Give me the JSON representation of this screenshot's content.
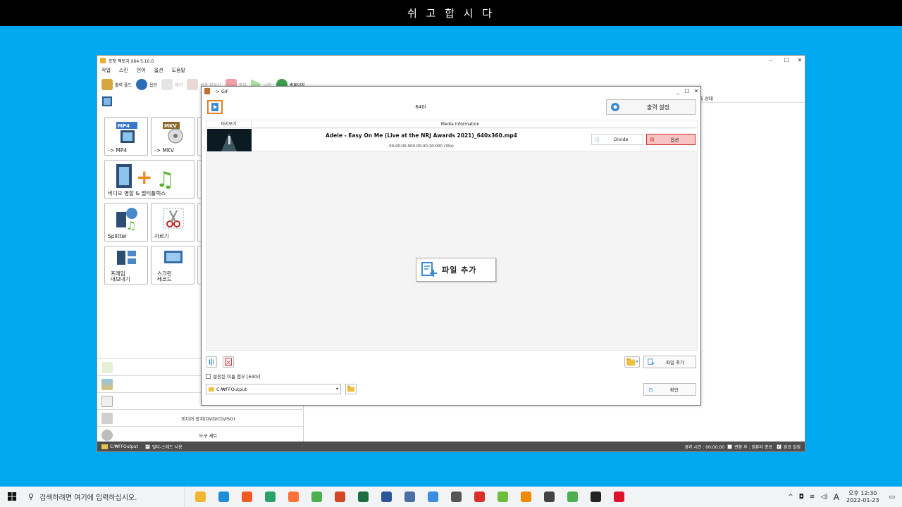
{
  "banner": "쉬 고 합 시 다",
  "main_window": {
    "title": "포맷 팩토리 X64 5.10.0",
    "menu": [
      "작업",
      "스킨",
      "언어",
      "옵션",
      "도움말"
    ],
    "toolbar": [
      {
        "label": "출력 폴드",
        "enabled": true,
        "icon": "output-folder-icon"
      },
      {
        "label": "옵션",
        "enabled": true,
        "icon": "options-icon"
      },
      {
        "label": "제거",
        "enabled": false,
        "icon": "remove-icon"
      },
      {
        "label": "목록 지우기",
        "enabled": false,
        "icon": "clear-list-icon"
      },
      {
        "label": "중지",
        "enabled": false,
        "icon": "stop-icon"
      },
      {
        "label": "시작",
        "enabled": false,
        "icon": "start-icon"
      },
      {
        "label": "홈페이지",
        "enabled": true,
        "icon": "homepage-icon"
      }
    ],
    "tiles": {
      "mp4": "-> MP4",
      "mkv": "-> MKV",
      "merge": "비디오 병합 & 멀티플렉스",
      "splitter": "Splitter",
      "crop": "자르기",
      "frame_export_l1": "프레임",
      "frame_export_l2": "내보내기",
      "screen_rec_l1": "스크린",
      "screen_rec_l2": "레코드"
    },
    "sidebar": [
      {
        "label": "",
        "icon": "audio-icon"
      },
      {
        "label": "",
        "icon": "image-icon"
      },
      {
        "label": "",
        "icon": "document-icon"
      },
      {
        "label": "미디어 장치(DVD/CD/ISO)",
        "icon": "disc-icon"
      },
      {
        "label": "도구 세트",
        "icon": "toolbox-icon"
      }
    ],
    "right_header_label": "출 상태",
    "status": {
      "path": "C:₩FFOutput",
      "multithread": "멀티-스레드 사용",
      "elapsed": "경과 시간 : 00:00:00",
      "after_convert": "변환 후 : 컴퓨터 종료",
      "notify": "완료 알림"
    }
  },
  "dialog": {
    "title": "-> GIF",
    "format": "640i",
    "output_settings_label": "출력 설정",
    "columns": {
      "preview": "미리보기",
      "media_info": "Media information"
    },
    "file": {
      "name": "Adele - Easy On Me (Live at the NRJ Awards 2021)_640x360.mp4",
      "duration": "00:00:00.000-00:00:30.000 (30s)",
      "divide_label": "Divide",
      "options_label": "옵션"
    },
    "add_file_big_label": "파일 추가",
    "add_file_small_label": "파일 추가",
    "attach_setting_name": "설정된 이름 첨부 [640i]",
    "output_path": "C:₩FFOutput",
    "ok_label": "확인"
  },
  "taskbar": {
    "search_placeholder": "검색하려면 여기에 입력하십시오.",
    "apps": [
      {
        "name": "file-explorer",
        "color": "#f2b632"
      },
      {
        "name": "edge",
        "color": "#1a8fd8"
      },
      {
        "name": "brave",
        "color": "#f05a24"
      },
      {
        "name": "edge-dev",
        "color": "#2aa36b"
      },
      {
        "name": "firefox",
        "color": "#ff7139"
      },
      {
        "name": "chrome",
        "color": "#4caf50"
      },
      {
        "name": "powerpoint",
        "color": "#d24726"
      },
      {
        "name": "excel",
        "color": "#1d6f42"
      },
      {
        "name": "word",
        "color": "#2b579a"
      },
      {
        "name": "calculator-app",
        "color": "#4a6fa5"
      },
      {
        "name": "remote-desktop",
        "color": "#3a8dde"
      },
      {
        "name": "search-app",
        "color": "#555555"
      },
      {
        "name": "se-app",
        "color": "#d9302c"
      },
      {
        "name": "android-app",
        "color": "#6bbf3b"
      },
      {
        "name": "vlc",
        "color": "#f08a00"
      },
      {
        "name": "calculator",
        "color": "#444444"
      },
      {
        "name": "chrome-alt",
        "color": "#4caf50"
      },
      {
        "name": "sticky",
        "color": "#222222"
      },
      {
        "name": "opera",
        "color": "#e0112b"
      }
    ],
    "ime_label": "A",
    "clock_time": "오후 12:30",
    "clock_date": "2022-01-23"
  }
}
